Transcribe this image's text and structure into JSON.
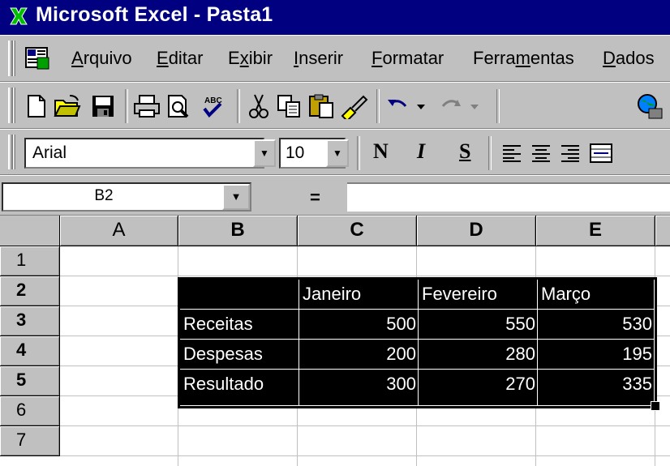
{
  "window": {
    "title": "Microsoft Excel - Pasta1"
  },
  "menu": {
    "items": [
      {
        "label": "Arquivo",
        "u": "A",
        "rest": "rquivo"
      },
      {
        "label": "Editar",
        "u": "E",
        "rest": "ditar"
      },
      {
        "label": "Exibir",
        "pre": "E",
        "u": "x",
        "rest": "ibir"
      },
      {
        "label": "Inserir",
        "u": "I",
        "rest": "nserir"
      },
      {
        "label": "Formatar",
        "u": "F",
        "rest": "ormatar"
      },
      {
        "label": "Ferramentas",
        "pre": "Ferra",
        "u": "m",
        "rest": "entas"
      },
      {
        "label": "Dados",
        "u": "D",
        "rest": "ados"
      }
    ]
  },
  "toolbar_formatting": {
    "font": "Arial",
    "size": "10",
    "bold_label": "N",
    "italic_label": "I",
    "underline_label": "S"
  },
  "formula_bar": {
    "name_box": "B2",
    "equals": "="
  },
  "sheet": {
    "columns": [
      "A",
      "B",
      "C",
      "D",
      "E"
    ],
    "rows": [
      "1",
      "2",
      "3",
      "4",
      "5",
      "6",
      "7"
    ],
    "header_row": [
      "",
      "Janeiro",
      "Fevereiro",
      "Março"
    ],
    "data_rows": [
      {
        "label": "Receitas",
        "values": [
          "500",
          "550",
          "530"
        ]
      },
      {
        "label": "Despesas",
        "values": [
          "200",
          "280",
          "195"
        ]
      },
      {
        "label": "Resultado",
        "values": [
          "300",
          "270",
          "335"
        ]
      }
    ]
  }
}
